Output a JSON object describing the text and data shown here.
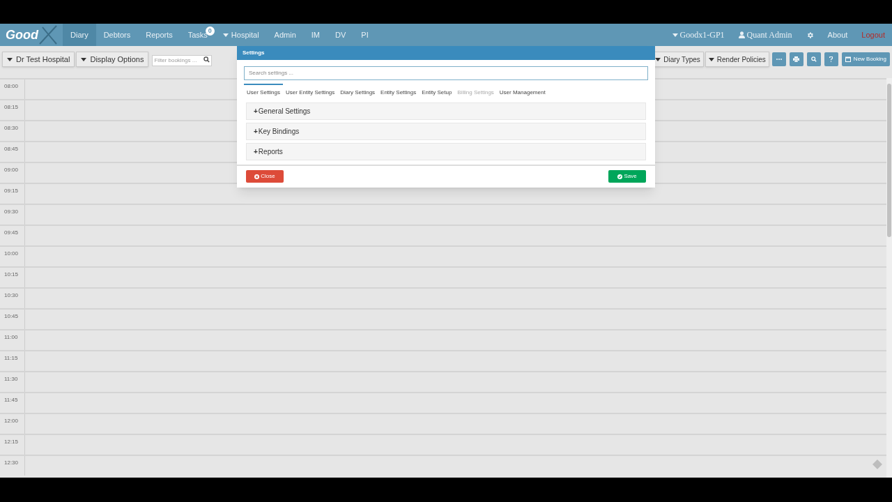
{
  "nav": {
    "logo": "Good",
    "items": [
      {
        "label": "Diary",
        "selected": true,
        "kind": "link"
      },
      {
        "label": "Debtors",
        "selected": false,
        "kind": "link"
      },
      {
        "label": "Reports",
        "selected": false,
        "kind": "link"
      },
      {
        "label": "Tasks",
        "selected": false,
        "kind": "badge",
        "badge": "0"
      },
      {
        "label": "Hospital",
        "selected": false,
        "kind": "dropdown"
      },
      {
        "label": "Admin",
        "selected": false,
        "kind": "link"
      },
      {
        "label": "IM",
        "selected": false,
        "kind": "link"
      },
      {
        "label": "DV",
        "selected": false,
        "kind": "link"
      },
      {
        "label": "PI",
        "selected": false,
        "kind": "link"
      }
    ],
    "right": [
      {
        "label": "Goodx1-GP1",
        "kind": "dropdown"
      },
      {
        "label": "Quant Admin",
        "kind": "user"
      },
      {
        "kind": "gear"
      },
      {
        "label": "About",
        "kind": "link"
      },
      {
        "label": "Logout",
        "kind": "logout"
      }
    ]
  },
  "toolbar": {
    "left": [
      "Dr Test Hospital",
      "Display Options"
    ],
    "filter_placeholder": "Filter bookings ...",
    "right": [
      "Diary Types",
      "Render Policies"
    ],
    "new_booking": "New Booking"
  },
  "times": [
    "08:00",
    "08:15",
    "08:30",
    "08:45",
    "09:00",
    "09:15",
    "09:30",
    "09:45",
    "10:00",
    "10:15",
    "10:30",
    "10:45",
    "11:00",
    "11:15",
    "11:30",
    "11:45",
    "12:00",
    "12:15",
    "12:30"
  ],
  "dialog": {
    "title": "Settings",
    "search_placeholder": "Search settings ...",
    "tabs": [
      {
        "label": "User Settings",
        "selected": true,
        "disabled": false
      },
      {
        "label": "User Entity Settings",
        "selected": false,
        "disabled": false
      },
      {
        "label": "Diary Settings",
        "selected": false,
        "disabled": false
      },
      {
        "label": "Entity Settings",
        "selected": false,
        "disabled": false
      },
      {
        "label": "Entity Setup",
        "selected": false,
        "disabled": false
      },
      {
        "label": "Billing Settings",
        "selected": false,
        "disabled": true
      },
      {
        "label": "User Management",
        "selected": false,
        "disabled": false
      }
    ],
    "sections": [
      {
        "marker": "+",
        "label": "General Settings",
        "expanded": false
      },
      {
        "marker": "+",
        "label": "Key Bindings",
        "expanded": false
      },
      {
        "marker": "+",
        "label": "Reports",
        "expanded": false
      }
    ],
    "close": "Close",
    "save": "Save"
  }
}
